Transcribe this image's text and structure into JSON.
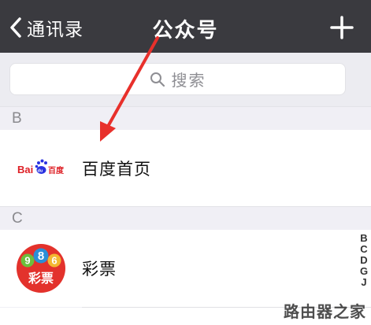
{
  "navbar": {
    "back_label": "通讯录",
    "title": "公众号",
    "add_icon": "plus-icon"
  },
  "search": {
    "placeholder": "搜索",
    "icon": "search-icon"
  },
  "sections": [
    {
      "letter": "B",
      "items": [
        {
          "name": "百度首页",
          "logo_text": "Bai百度"
        }
      ]
    },
    {
      "letter": "C",
      "items": [
        {
          "name": "彩票",
          "logo_digits": [
            "9",
            "8",
            "6"
          ],
          "logo_text": "彩票"
        }
      ]
    }
  ],
  "index_letters": [
    "B",
    "C",
    "D",
    "G",
    "J"
  ],
  "watermark": "路由器之家",
  "colors": {
    "navbar": "#3a3a3f",
    "annotation_arrow": "#e8302b",
    "baidu_red": "#de2026",
    "baidu_blue": "#2932e1",
    "lottery_red": "#e3322c"
  }
}
